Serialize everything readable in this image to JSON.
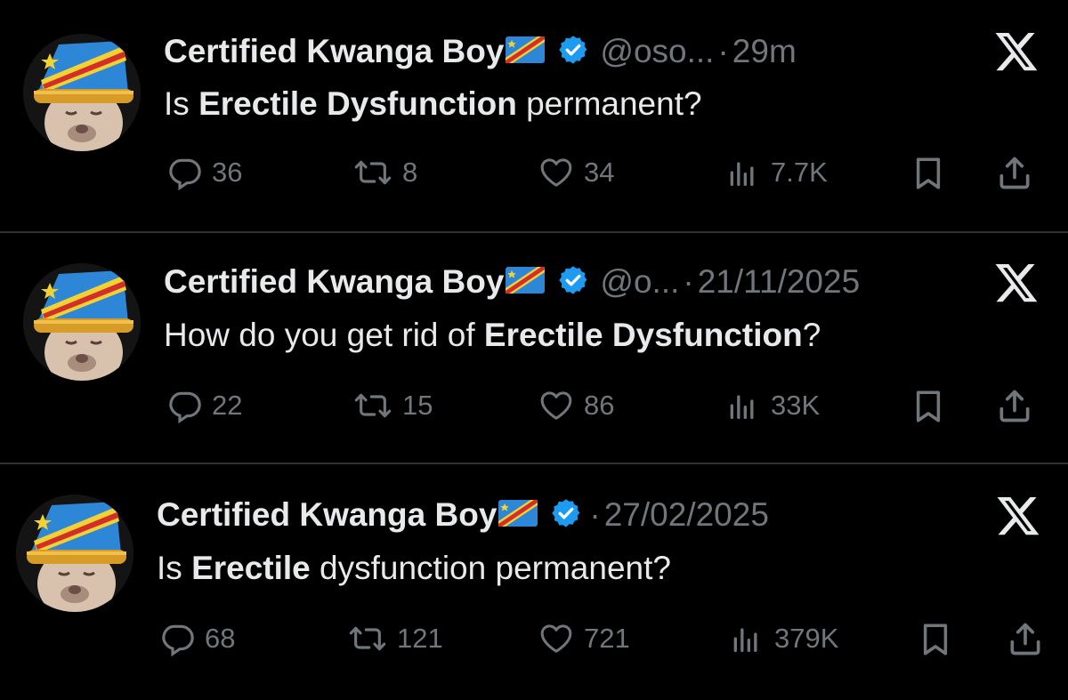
{
  "tweets": [
    {
      "name": "Certified Kwanga Boy",
      "handle": "@oso...",
      "time": "29m",
      "text_parts": [
        "Is ",
        "Erectile Dysfunction",
        " permanent?"
      ],
      "replies": "36",
      "retweets": "8",
      "likes": "34",
      "views": "7.7K"
    },
    {
      "name": "Certified Kwanga Boy",
      "handle": "@o...",
      "time": "21/11/2025",
      "text_parts": [
        "How do you get rid of ",
        "Erectile Dysfunction",
        "?"
      ],
      "replies": "22",
      "retweets": "15",
      "likes": "86",
      "views": "33K"
    },
    {
      "name": "Certified Kwanga Boy",
      "time": "27/02/2025",
      "text_parts": [
        "Is ",
        "Erectile",
        " dysfunction permanent?"
      ],
      "replies": "68",
      "retweets": "121",
      "likes": "721",
      "views": "379K"
    }
  ],
  "colors": {
    "background": "#000000",
    "text": "#e7e9ea",
    "muted": "#71767b",
    "verified": "#1d9bf0",
    "separator": "#2f3336"
  },
  "icons": [
    "reply-icon",
    "retweet-icon",
    "like-icon",
    "views-icon",
    "bookmark-icon",
    "share-icon",
    "x-logo-icon",
    "verified-badge-icon",
    "drc-flag-icon"
  ]
}
